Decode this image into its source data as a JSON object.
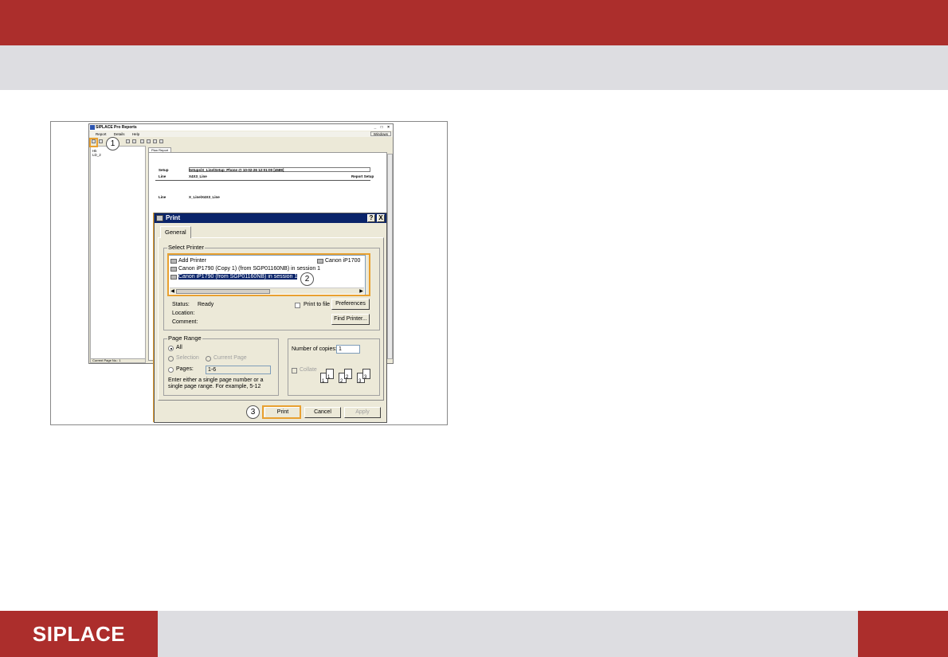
{
  "footer": {
    "logo": "SIPLACE"
  },
  "app": {
    "title": "SIPLACE Pro Reports",
    "menu": [
      "Report",
      "Details",
      "Help"
    ],
    "window_menu": "Windows",
    "tree": [
      "Hk",
      "LD_2"
    ],
    "status": "Current Page No.: 1",
    "tab": "Plan Report",
    "report": {
      "setup_label": "Setup",
      "setup_value": "Setups\\X_Line\\Setup_Phone @ 10-02-26 12:01:00 [4589]",
      "line_label": "Line",
      "line_value": "X4X3_Line",
      "report_setup": "Report Setup",
      "line2_label": "Line",
      "line2_value": "X_Line\\X4X3_Line"
    }
  },
  "callouts": {
    "one": "1",
    "two": "2",
    "three": "3"
  },
  "dialog": {
    "title": "Print",
    "help_btn": "?",
    "close_btn": "X",
    "tab": "General",
    "select_printer_legend": "Select Printer",
    "printers": [
      "Add Printer",
      "Canon iP1700",
      "Canon iP1790 (Copy 1) (from SGP01160NB) in session 1",
      "Canon iP1790 (from SGP01160NB) in session 1"
    ],
    "status_label": "Status:",
    "status_value": "Ready",
    "location_label": "Location:",
    "comment_label": "Comment:",
    "print_to_file": "Print to file",
    "preferences": "Preferences",
    "find_printer": "Find Printer...",
    "page_range_legend": "Page Range",
    "all": "All",
    "selection": "Selection",
    "current_page": "Current Page",
    "pages": "Pages:",
    "pages_value": "1-6",
    "hint": "Enter either a single page number or a single page range.  For example, 5-12",
    "copies_label": "Number of copies:",
    "copies_value": "1",
    "collate": "Collate",
    "collate_pages": [
      "1",
      "1",
      "2",
      "2",
      "3",
      "3"
    ],
    "print": "Print",
    "cancel": "Cancel",
    "apply": "Apply"
  }
}
